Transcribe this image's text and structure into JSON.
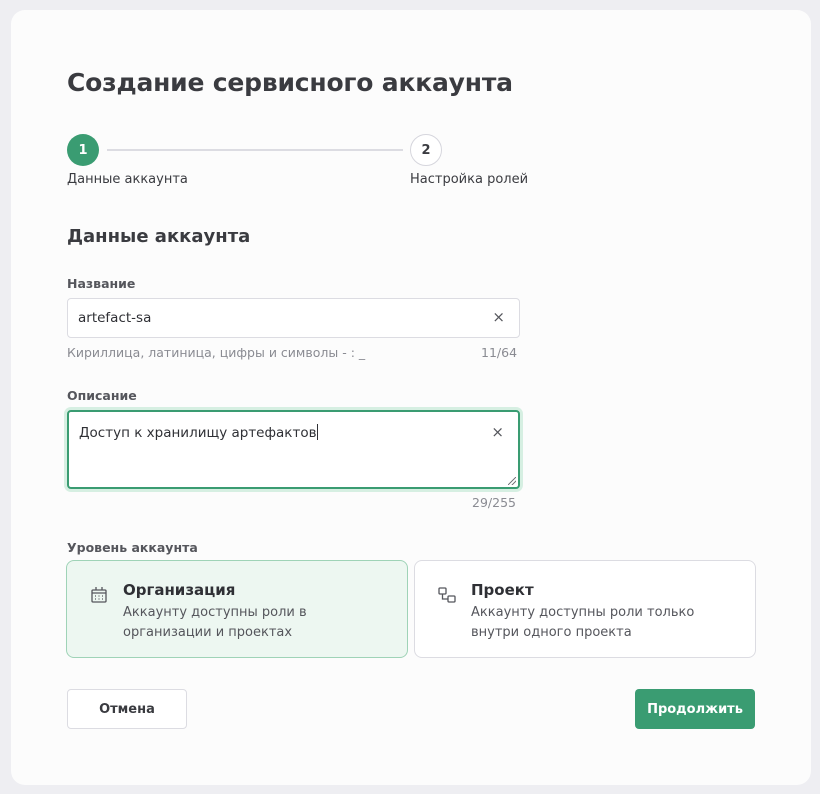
{
  "dialog": {
    "title": "Создание сервисного аккаунта"
  },
  "stepper": {
    "steps": [
      {
        "number": "1",
        "label": "Данные аккаунта"
      },
      {
        "number": "2",
        "label": "Настройка ролей"
      }
    ]
  },
  "section": {
    "title": "Данные аккаунта"
  },
  "name_field": {
    "label": "Название",
    "value": "artefact-sa",
    "hint": "Кириллица, латиница, цифры и символы - : _",
    "counter": "11/64"
  },
  "description_field": {
    "label": "Описание",
    "value": "Доступ к хранилищу артефактов",
    "counter": "29/255"
  },
  "level": {
    "label": "Уровень аккаунта",
    "options": [
      {
        "title": "Организация",
        "description": "Аккаунту доступны роли в организации и проектах",
        "icon": "building-icon"
      },
      {
        "title": "Проект",
        "description": "Аккаунту доступны роли только внутри одного проекта",
        "icon": "project-icon"
      }
    ]
  },
  "actions": {
    "cancel_label": "Отмена",
    "continue_label": "Продолжить"
  },
  "colors": {
    "accent": "#3a9c72",
    "selected_bg": "#edf7f1"
  },
  "icons": {
    "clear": "×"
  }
}
